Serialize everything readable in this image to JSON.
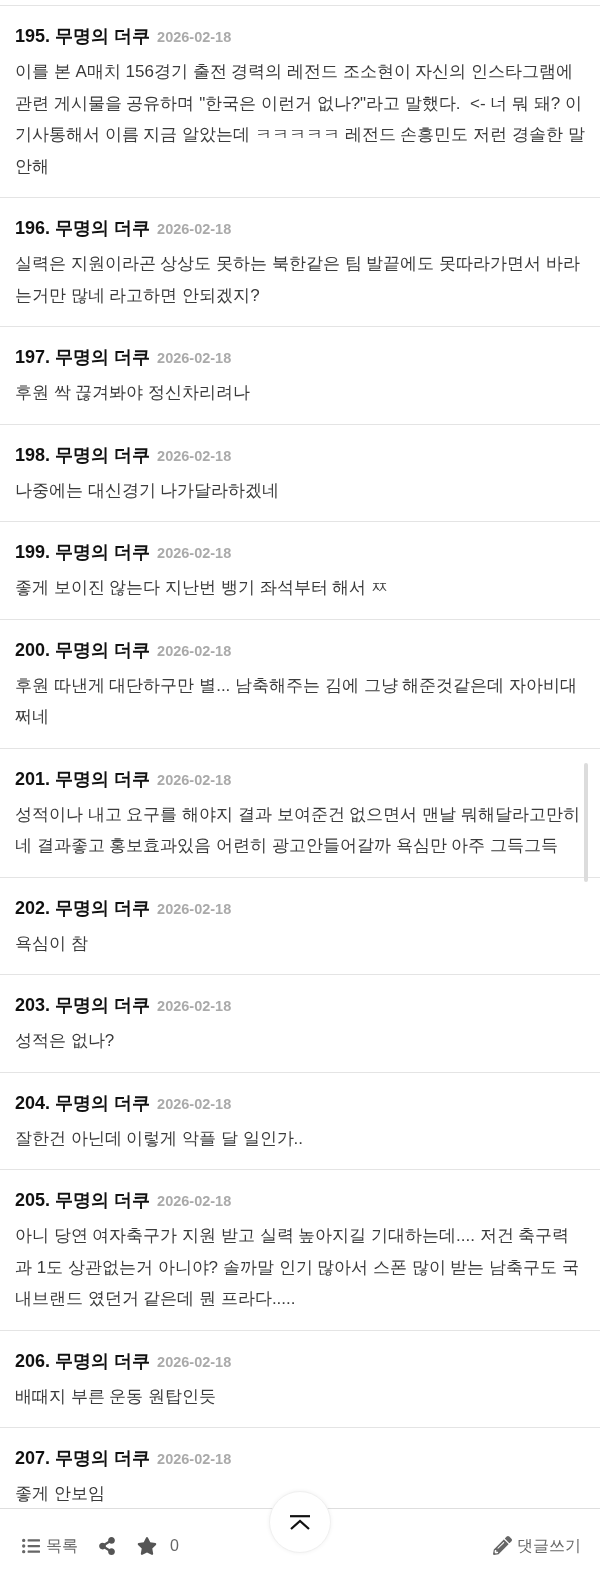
{
  "comments": [
    {
      "number": "195.",
      "author": "무명의 더쿠",
      "date": "2026-02-18",
      "text": "이를 본 A매치 156경기 출전 경력의 레전드 조소현이 자신의 인스타그램에 관련 게시물을 공유하며 \"한국은 이런거 없나?\"라고 말했다.  <- 너 뭐 돼? 이 기사통해서 이름 지금 알았는데 ㅋㅋㅋㅋㅋ 레전드 손흥민도 저런 경솔한 말 안해"
    },
    {
      "number": "196.",
      "author": "무명의 더쿠",
      "date": "2026-02-18",
      "text": "실력은 지원이라곤 상상도 못하는 북한같은 팀 발끝에도 못따라가면서 바라는거만 많네 라고하면 안되겠지?"
    },
    {
      "number": "197.",
      "author": "무명의 더쿠",
      "date": "2026-02-18",
      "text": "후원 싹 끊겨봐야 정신차리려나"
    },
    {
      "number": "198.",
      "author": "무명의 더쿠",
      "date": "2026-02-18",
      "text": "나중에는 대신경기 나가달라하겠네"
    },
    {
      "number": "199.",
      "author": "무명의 더쿠",
      "date": "2026-02-18",
      "text": "좋게 보이진 않는다 지난번 뱅기 좌석부터 해서 ㅉ"
    },
    {
      "number": "200.",
      "author": "무명의 더쿠",
      "date": "2026-02-18",
      "text": "후원 따낸게 대단하구만 별... 남축해주는 김에 그냥 해준것같은데 자아비대쩌네"
    },
    {
      "number": "201.",
      "author": "무명의 더쿠",
      "date": "2026-02-18",
      "text": "성적이나 내고 요구를 해야지 결과 보여준건 없으면서 맨날 뭐해달라고만히네 결과좋고 홍보효과있음 어련히 광고안들어갈까 욕심만 아주 그득그득"
    },
    {
      "number": "202.",
      "author": "무명의 더쿠",
      "date": "2026-02-18",
      "text": "욕심이 참"
    },
    {
      "number": "203.",
      "author": "무명의 더쿠",
      "date": "2026-02-18",
      "text": "성적은 없나?"
    },
    {
      "number": "204.",
      "author": "무명의 더쿠",
      "date": "2026-02-18",
      "text": "잘한건 아닌데 이렇게 악플 달 일인가.."
    },
    {
      "number": "205.",
      "author": "무명의 더쿠",
      "date": "2026-02-18",
      "text": "아니 당연 여자축구가 지원 받고 실력 높아지길 기대하는데.... 저건 축구력과 1도 상관없는거 아니야? 솔까말 인기 많아서 스폰 많이 받는 남축구도 국내브랜드 였던거 같은데 뭔 프라다....."
    },
    {
      "number": "206.",
      "author": "무명의 더쿠",
      "date": "2026-02-18",
      "text": "배때지 부른 운동 원탑인듯"
    },
    {
      "number": "207.",
      "author": "무명의 더쿠",
      "date": "2026-02-18",
      "text": "좋게 안보임"
    }
  ],
  "bottom_bar": {
    "list_label": "목록",
    "star_count": "0",
    "write_label": "댓글쓰기"
  }
}
